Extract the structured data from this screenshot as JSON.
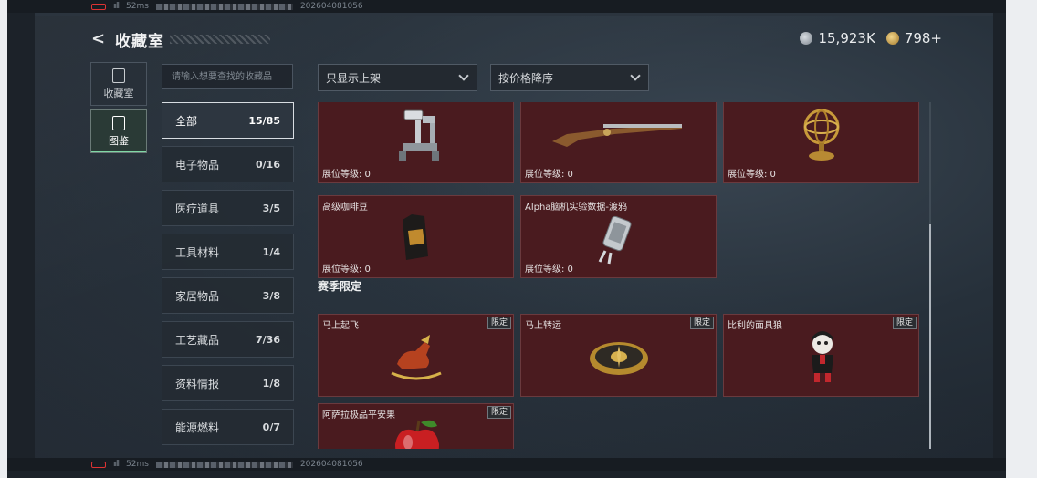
{
  "status": {
    "ping": "52ms",
    "id_suffix": "202604081056",
    "signal": "ııll"
  },
  "header": {
    "title": "收藏室",
    "back_glyph": "<",
    "silver_amount": "15,923K",
    "gold_amount": "798+"
  },
  "nav": [
    {
      "label": "收藏室",
      "active": false
    },
    {
      "label": "图鉴",
      "active": true
    }
  ],
  "search": {
    "placeholder": "请输入想要查找的收藏品"
  },
  "filters": {
    "display": "只显示上架",
    "sort": "按价格降序"
  },
  "categories": [
    {
      "label": "全部",
      "count": "15/85",
      "active": true
    },
    {
      "label": "电子物品",
      "count": "0/16"
    },
    {
      "label": "医疗道具",
      "count": "3/5"
    },
    {
      "label": "工具材料",
      "count": "1/4"
    },
    {
      "label": "家居物品",
      "count": "3/8"
    },
    {
      "label": "工艺藏品",
      "count": "7/36"
    },
    {
      "label": "资料情报",
      "count": "1/8"
    },
    {
      "label": "能源燃料",
      "count": "0/7"
    }
  ],
  "items_top": [
    {
      "name": "",
      "level": "展位等级: 0",
      "icon": "surgical-robot-icon"
    },
    {
      "name": "",
      "level": "展位等级: 0",
      "icon": "flintlock-rifle-icon"
    },
    {
      "name": "",
      "level": "展位等级: 0",
      "icon": "armillary-sphere-icon"
    },
    {
      "name": "高级咖啡豆",
      "level": "展位等级: 0",
      "icon": "coffee-bag-icon"
    },
    {
      "name": "Alpha脑机实验数据-渡鸦",
      "level": "展位等级: 0",
      "icon": "data-cylinder-icon"
    }
  ],
  "section_title": "赛季限定",
  "items_season": [
    {
      "name": "马上起飞",
      "tag": "限定",
      "icon": "rocking-horse-icon"
    },
    {
      "name": "马上转运",
      "tag": "限定",
      "icon": "golden-compass-icon"
    },
    {
      "name": "比利的面具狼",
      "tag": "限定",
      "icon": "puppet-doll-icon"
    },
    {
      "name": "阿萨拉极品平安果",
      "tag": "限定",
      "icon": "red-apple-icon"
    }
  ],
  "colors": {
    "card_bg": "#4a1b1f",
    "accent_green": "#7fd7a5",
    "text": "#e5e1e1"
  }
}
